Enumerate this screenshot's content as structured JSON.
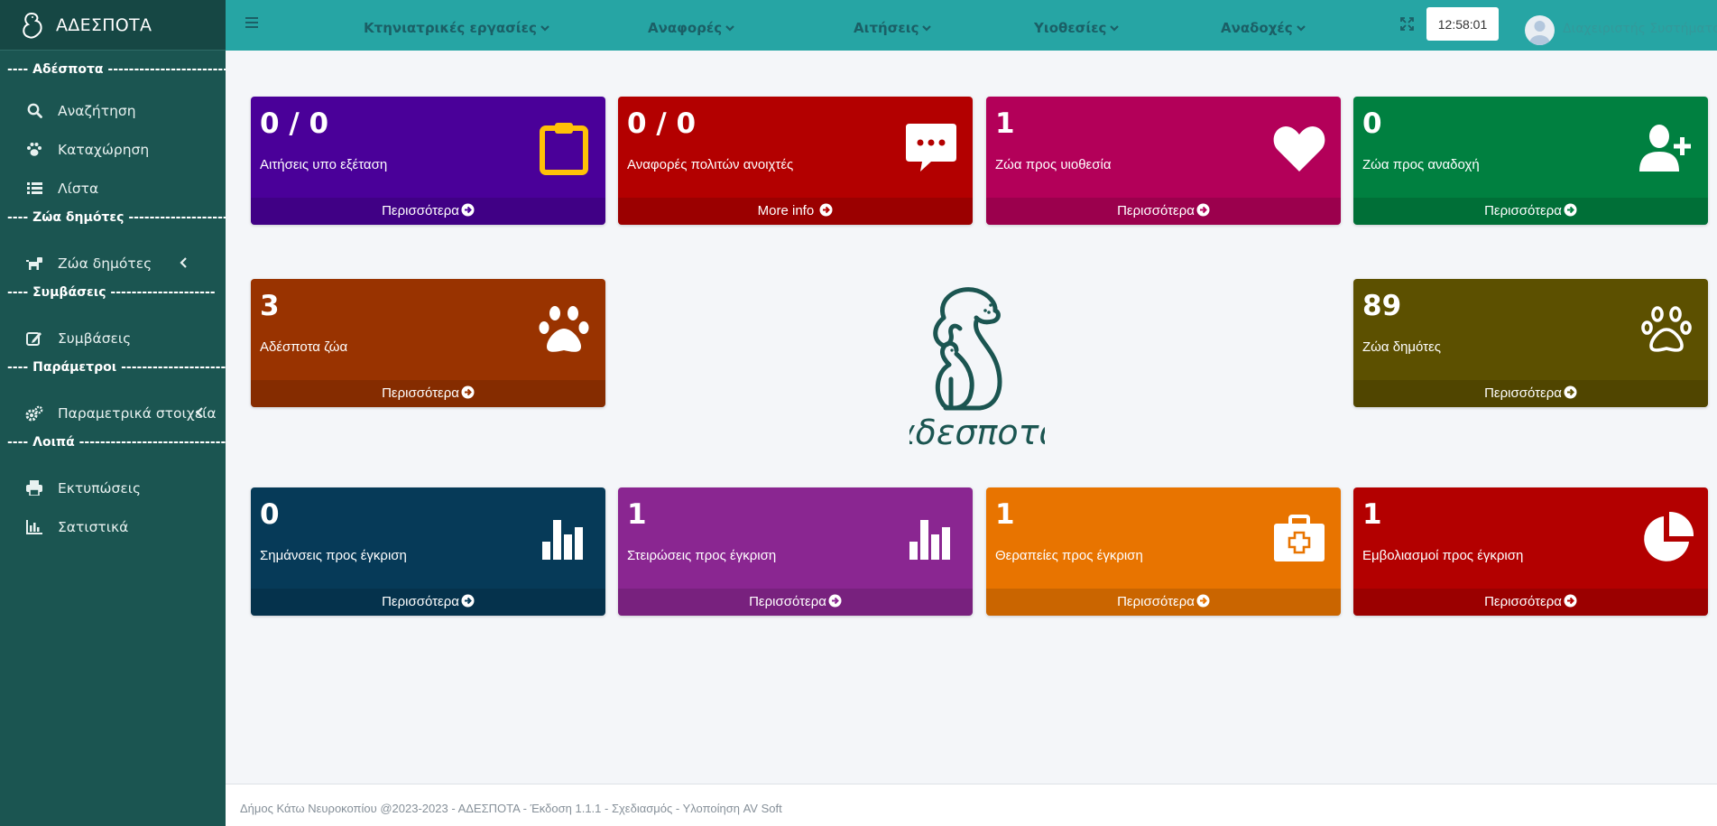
{
  "brand": {
    "title": "ΑΔΕΣΠΟΤΑ"
  },
  "sidebar": {
    "sections": [
      "---- Αδέσποτα ------------------------",
      "---- Ζώα δημότες --------------------",
      "---- Συμβάσεις --------------------",
      "---- Παράμετροι ---------------------",
      "---- Λοιπά ----------------------------"
    ],
    "items": [
      {
        "label": "Αναζήτηση",
        "icon": "search-icon"
      },
      {
        "label": "Καταχώρηση",
        "icon": "paw-icon"
      },
      {
        "label": "Λίστα",
        "icon": "list-icon"
      },
      {
        "label": "Ζώα δημότες",
        "icon": "dog-icon"
      },
      {
        "label": "Συμβάσεις",
        "icon": "edit-icon"
      },
      {
        "label": "Παραμετρικά στοιχεία",
        "icon": "gears-icon"
      },
      {
        "label": "Εκτυπώσεις",
        "icon": "printer-icon"
      },
      {
        "label": "Σατιστικά",
        "icon": "bar-chart-icon"
      }
    ]
  },
  "topbar": {
    "menus": [
      "Κτηνιατρικές εργασίες",
      "Αναφορές",
      "Αιτήσεις",
      "Υιοθεσίες",
      "Αναδοχές"
    ],
    "clock": "12:58:01",
    "username": "Διαχειριστής Συστήματος"
  },
  "cards": [
    {
      "value": "0 / 0",
      "label": "Αιτήσεις υπο εξέταση",
      "more": "Περισσότερα",
      "color": "#4a0099",
      "icon": "clipboard-icon"
    },
    {
      "value": "0 / 0",
      "label": "Αναφορές πολιτών ανοιχτές",
      "more": "More info",
      "color": "#b30000",
      "icon": "comment-icon"
    },
    {
      "value": "1",
      "label": "Ζώα προς υιοθεσία",
      "more": "Περισσότερα",
      "color": "#b30059",
      "icon": "heart-icon"
    },
    {
      "value": "0",
      "label": "Ζώα προς αναδοχή",
      "more": "Περισσότερα",
      "color": "#008040",
      "icon": "user-plus-icon"
    },
    {
      "value": "3",
      "label": "Αδέσποτα ζώα",
      "more": "Περισσότερα",
      "color": "#993300",
      "icon": "paw-icon"
    },
    {
      "value": "89",
      "label": "Ζώα δημότες",
      "more": "Περισσότερα",
      "color": "#5c5000",
      "icon": "paw-outline-icon"
    },
    {
      "value": "0",
      "label": "Σημάνσεις προς έγκριση",
      "more": "Περισσότερα",
      "color": "#063a58",
      "icon": "bar-chart-icon"
    },
    {
      "value": "1",
      "label": "Στειρώσεις προς έγκριση",
      "more": "Περισσότερα",
      "color": "#8a2691",
      "icon": "bar-chart-icon"
    },
    {
      "value": "1",
      "label": "Θεραπείες προς έγκριση",
      "more": "Περισσότερα",
      "color": "#e87400",
      "icon": "medkit-icon"
    },
    {
      "value": "1",
      "label": "Εμβολιασμοί προς έγκριση",
      "more": "Περισσότερα",
      "color": "#b30000",
      "icon": "pie-chart-icon"
    }
  ],
  "center_logo": {
    "text": "αδεσποτα",
    "color": "#1b5551"
  },
  "footer": {
    "text": "Δήμος Κάτω Νευροκοπίου @2023-2023 - ΑΔΕΣΠΟΤΑ - Έκδοση 1.1.1 - Σχεδιασμός - Υλοποίηση AV Soft"
  }
}
